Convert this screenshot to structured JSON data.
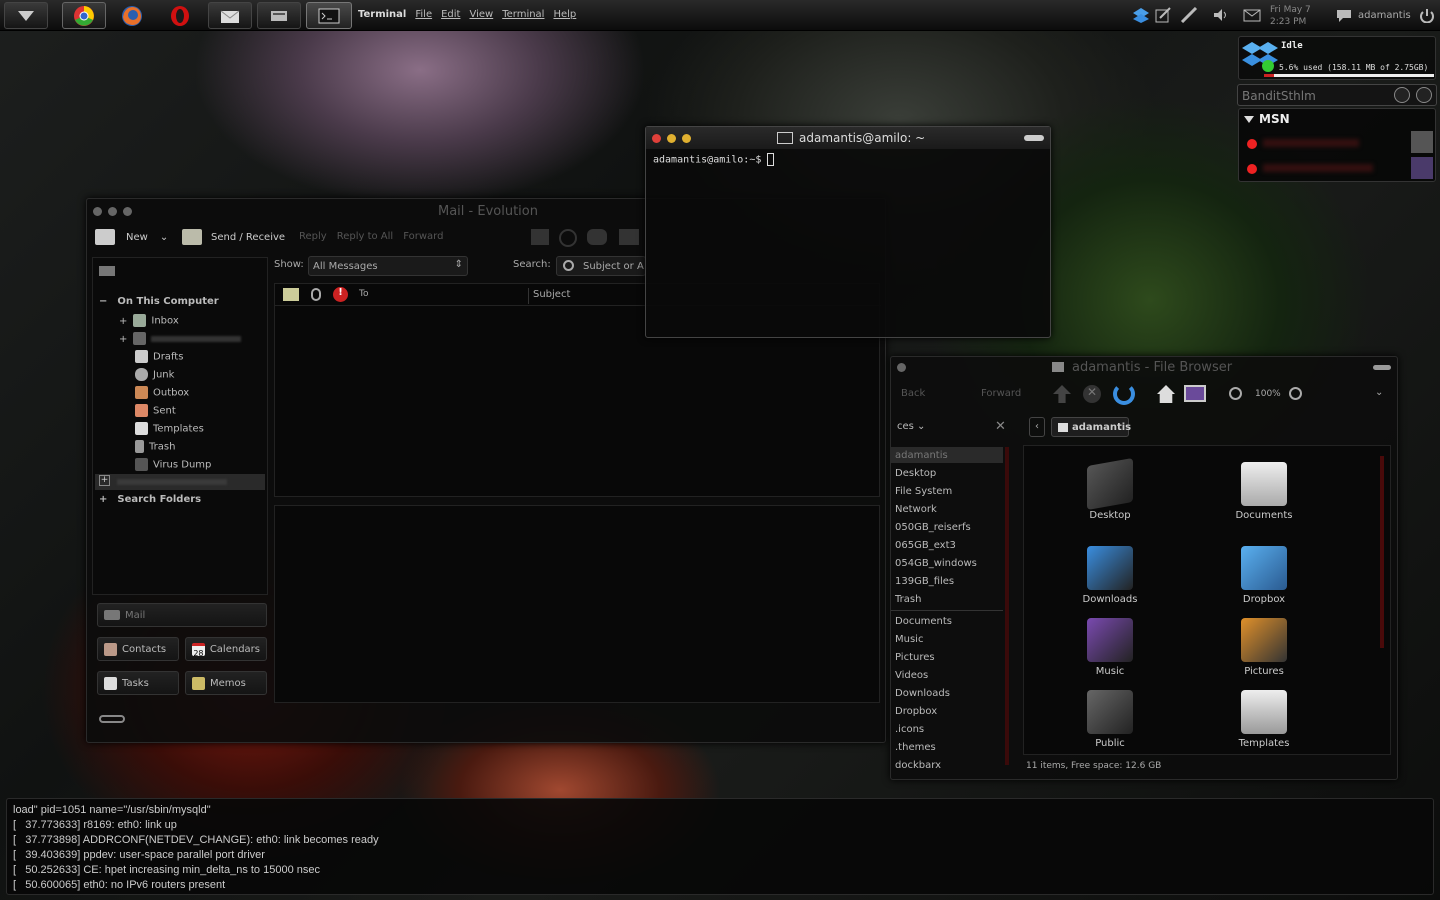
{
  "panel": {
    "app_name": "Terminal",
    "menus": [
      "File",
      "Edit",
      "View",
      "Terminal",
      "Help"
    ],
    "clock": {
      "date": "Fri May 7",
      "time": "2:23 PM"
    },
    "user": "adamantis"
  },
  "dropbox_widget": {
    "status": "Idle",
    "usage": "5.6% used (158.11 MB of 2.75GB)"
  },
  "msn_widget": {
    "input_value": "BanditSthlm",
    "section": "MSN"
  },
  "terminal": {
    "title": "adamantis@amilo: ~",
    "prompt": "adamantis@amilo:~$"
  },
  "evolution": {
    "title": "Mail - Evolution",
    "toolbar": {
      "new": "New",
      "send_receive": "Send / Receive",
      "reply": "Reply",
      "reply_all": "Reply to All",
      "forward": "Forward"
    },
    "folders": {
      "group": "On This Computer",
      "items": [
        "Inbox",
        "Drafts",
        "Junk",
        "Outbox",
        "Sent",
        "Templates",
        "Trash",
        "Virus Dump"
      ],
      "search_folders": "Search Folders"
    },
    "filter": {
      "show_label": "Show:",
      "show_value": "All Messages",
      "search_label": "Search:",
      "search_value": "Subject or A"
    },
    "columns": {
      "to": "To",
      "subject": "Subject"
    },
    "switcher": {
      "mail": "Mail",
      "contacts": "Contacts",
      "calendars": "Calendars",
      "calendar_day": "28",
      "tasks": "Tasks",
      "memos": "Memos"
    }
  },
  "filebrowser": {
    "title": "adamantis - File Browser",
    "toolbar": {
      "back": "Back",
      "forward": "Forward",
      "zoom": "100%"
    },
    "sidebar_title": "ces",
    "location": "adamantis",
    "places": [
      "adamantis",
      "Desktop",
      "File System",
      "Network",
      "050GB_reiserfs",
      "065GB_ext3",
      "054GB_windows",
      "139GB_files",
      "Trash"
    ],
    "bookmarks": [
      "Documents",
      "Music",
      "Pictures",
      "Videos",
      "Downloads",
      "Dropbox",
      ".icons",
      ".themes",
      "dockbarx"
    ],
    "items": [
      "Desktop",
      "Documents",
      "Downloads",
      "Dropbox",
      "Music",
      "Pictures",
      "Public",
      "Templates"
    ],
    "status": "11 items, Free space: 12.6 GB"
  },
  "log_lines": [
    "load\" pid=1051 name=\"/usr/sbin/mysqld\"",
    "[   37.773633] r8169: eth0: link up",
    "[   37.773898] ADDRCONF(NETDEV_CHANGE): eth0: link becomes ready",
    "[   39.403639] ppdev: user-space parallel port driver",
    "[   50.252633] CE: hpet increasing min_delta_ns to 15000 nsec",
    "[   50.600065] eth0: no IPv6 routers present"
  ],
  "colors": {
    "accent_red": "#cc2020",
    "accent_blue": "#3a8ee0",
    "close": "#e0403a",
    "min": "#e0b030",
    "max": "#60c040"
  }
}
